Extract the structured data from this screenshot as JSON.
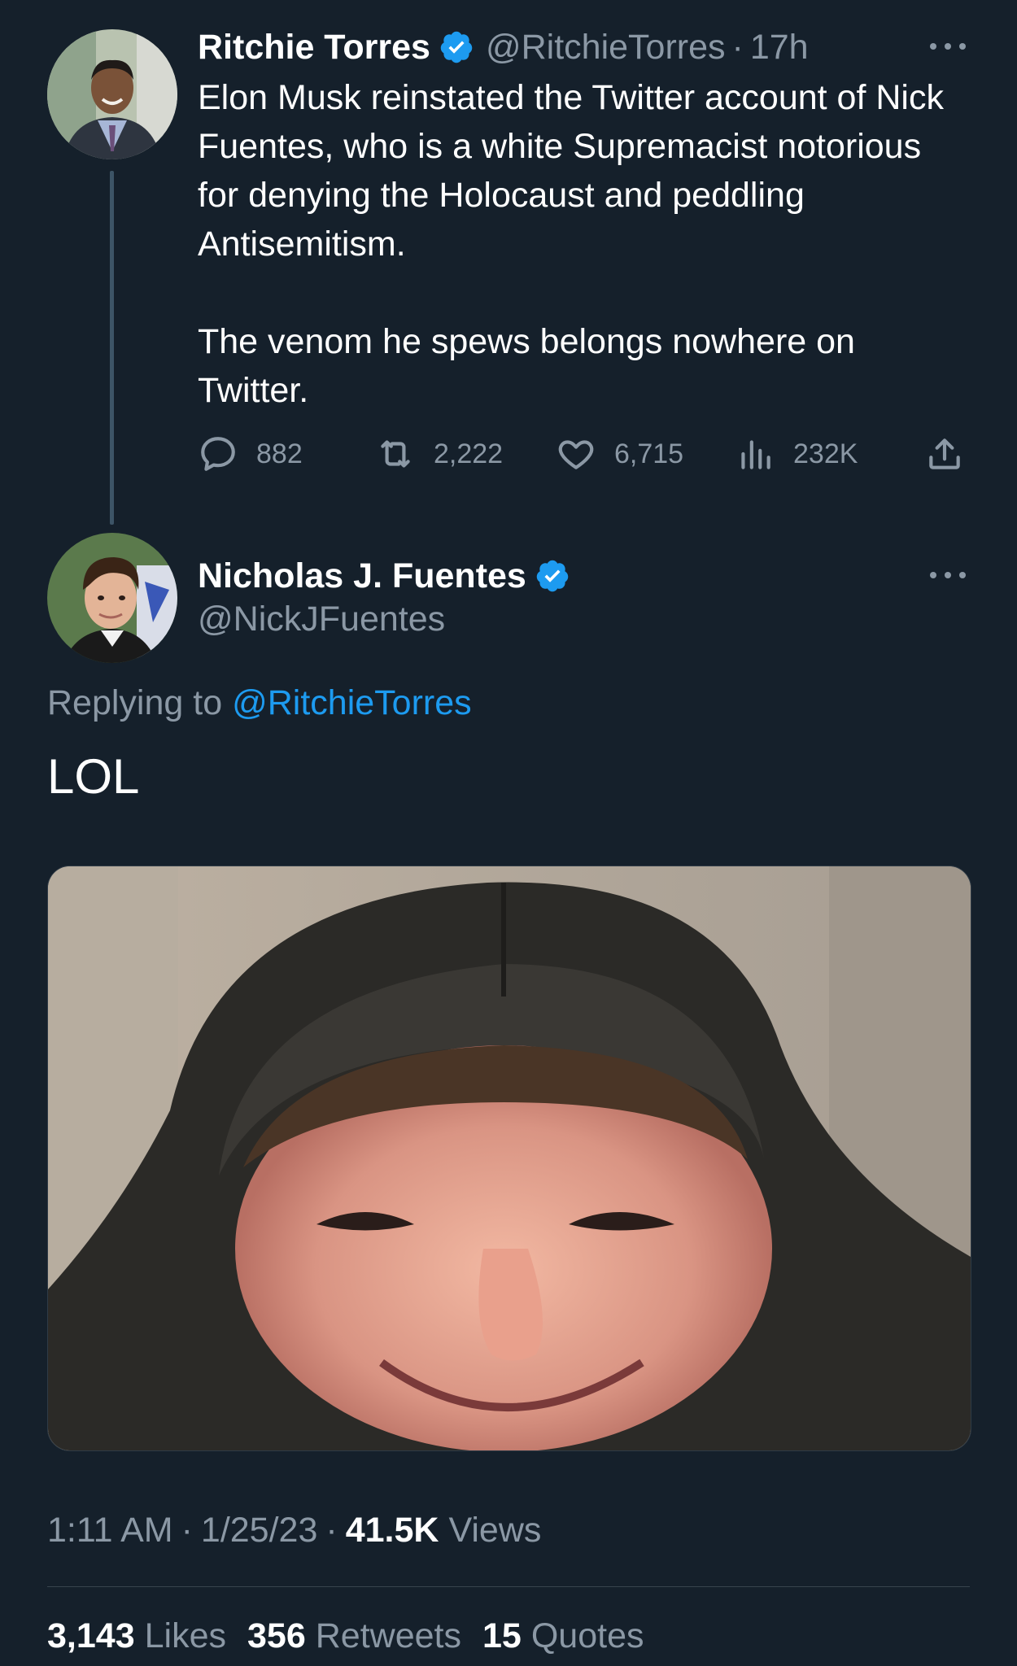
{
  "colors": {
    "background": "#15202b",
    "text_primary": "#ffffff",
    "text_secondary": "#8b98a5",
    "accent": "#1d9bf0",
    "verified_badge": "#1d9bf0",
    "thread_line": "#3d5466"
  },
  "parent_tweet": {
    "author_name": "Ritchie Torres",
    "handle": "@RitchieTorres",
    "separator": "·",
    "time": "17h",
    "verified_icon": "verified-badge-icon",
    "more_icon": "more-horizontal-icon",
    "body_paragraphs": [
      "Elon Musk reinstated the Twitter account of Nick Fuentes, who is a white Supremacist notorious for denying the Holocaust and peddling Antisemitism.",
      "The venom he spews belongs nowhere on Twitter."
    ],
    "actions": {
      "replies": "882",
      "retweets": "2,222",
      "likes": "6,715",
      "views": "232K",
      "reply_icon": "reply-bubble-icon",
      "retweet_icon": "retweet-icon",
      "like_icon": "heart-icon",
      "views_icon": "bar-chart-icon",
      "share_icon": "share-upload-icon"
    }
  },
  "reply_tweet": {
    "author_name": "Nicholas J. Fuentes",
    "handle": "@NickJFuentes",
    "verified_icon": "verified-badge-icon",
    "more_icon": "more-horizontal-icon",
    "replying_prefix": "Replying to",
    "replying_handle": "@RitchieTorres",
    "text": "LOL",
    "media_description_icon": "photo-icon",
    "time": "1:11 AM",
    "date": "1/25/23",
    "separator": "·",
    "views_count": "41.5K",
    "views_label": "Views",
    "stats": {
      "likes_count": "3,143",
      "likes_label": "Likes",
      "retweets_count": "356",
      "retweets_label": "Retweets",
      "quotes_count": "15",
      "quotes_label": "Quotes"
    }
  }
}
